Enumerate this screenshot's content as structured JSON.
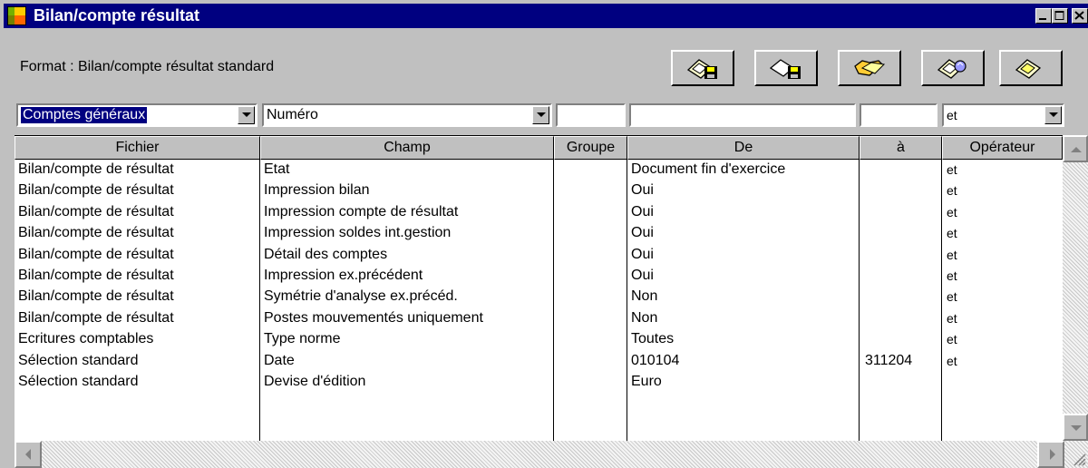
{
  "window": {
    "title": "Bilan/compte résultat",
    "controls": [
      "minimize-icon",
      "maximize-icon",
      "close-icon"
    ]
  },
  "format": {
    "label": "Format : Bilan/compte résultat standard"
  },
  "toolbar": {
    "buttons": [
      "save-format-icon",
      "save-as-format-icon",
      "open-folder-icon",
      "print-preview-icon",
      "print-icon"
    ]
  },
  "filters": {
    "file_select": "Comptes généraux",
    "field_select": "Numéro",
    "group_value": "",
    "from_value": "",
    "to_value": "",
    "operator_select": "et"
  },
  "table": {
    "columns": [
      "Fichier",
      "Champ",
      "Groupe",
      "De",
      "à",
      "Opérateur"
    ],
    "rows": [
      {
        "fichier": "Bilan/compte de résultat",
        "champ": "Etat",
        "groupe": "",
        "de": "Document fin d'exercice",
        "a": "",
        "operateur": "et"
      },
      {
        "fichier": "Bilan/compte de résultat",
        "champ": "Impression bilan",
        "groupe": "",
        "de": "Oui",
        "a": "",
        "operateur": "et"
      },
      {
        "fichier": "Bilan/compte de résultat",
        "champ": "Impression compte de résultat",
        "groupe": "",
        "de": "Oui",
        "a": "",
        "operateur": "et"
      },
      {
        "fichier": "Bilan/compte de résultat",
        "champ": "Impression soldes int.gestion",
        "groupe": "",
        "de": "Oui",
        "a": "",
        "operateur": "et"
      },
      {
        "fichier": "Bilan/compte de résultat",
        "champ": "Détail des comptes",
        "groupe": "",
        "de": "Oui",
        "a": "",
        "operateur": "et"
      },
      {
        "fichier": "Bilan/compte de résultat",
        "champ": "Impression ex.précédent",
        "groupe": "",
        "de": "Oui",
        "a": "",
        "operateur": "et"
      },
      {
        "fichier": "Bilan/compte de résultat",
        "champ": "Symétrie d'analyse ex.précéd.",
        "groupe": "",
        "de": "Non",
        "a": "",
        "operateur": "et"
      },
      {
        "fichier": "Bilan/compte de résultat",
        "champ": "Postes mouvementés uniquement",
        "groupe": "",
        "de": "Non",
        "a": "",
        "operateur": "et"
      },
      {
        "fichier": "Ecritures comptables",
        "champ": "Type norme",
        "groupe": "",
        "de": "Toutes",
        "a": "",
        "operateur": "et"
      },
      {
        "fichier": "Sélection standard",
        "champ": "Date",
        "groupe": "",
        "de": "010104",
        "a": "311204",
        "operateur": "et"
      },
      {
        "fichier": "Sélection standard",
        "champ": "Devise d'édition",
        "groupe": "",
        "de": "Euro",
        "a": "",
        "operateur": ""
      }
    ]
  },
  "colors": {
    "titlebar": "#000080",
    "face": "#c0c0c0",
    "selection": "#000080"
  }
}
